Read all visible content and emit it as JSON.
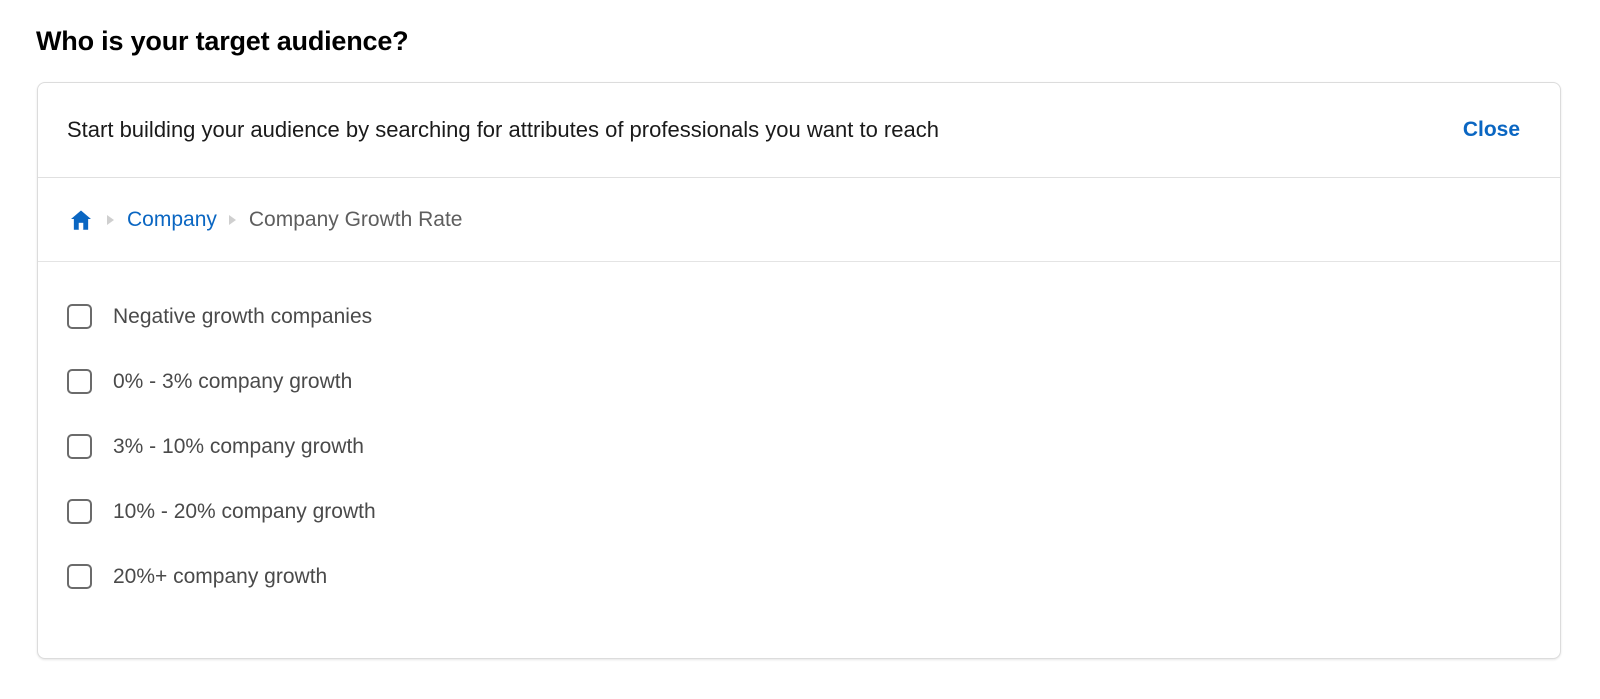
{
  "page": {
    "title": "Who is your target audience?"
  },
  "card": {
    "header": {
      "description": "Start building your audience by searching for attributes of professionals you want to reach",
      "close_label": "Close"
    },
    "breadcrumb": {
      "home_icon": "home-icon",
      "separator_icon": "caret-right-icon",
      "items": [
        {
          "label": "Company",
          "type": "link"
        },
        {
          "label": "Company Growth Rate",
          "type": "current"
        }
      ]
    },
    "options": [
      {
        "label": "Negative growth companies",
        "checked": false
      },
      {
        "label": "0% - 3% company growth",
        "checked": false
      },
      {
        "label": "3% - 10% company growth",
        "checked": false
      },
      {
        "label": "10% - 20% company growth",
        "checked": false
      },
      {
        "label": "20%+ company growth",
        "checked": false
      }
    ]
  },
  "colors": {
    "link": "#0a66c2",
    "text_primary": "#1a1a1a",
    "text_secondary": "#4a4a4a",
    "text_muted": "#5e5e5e",
    "border": "#dcdcdc",
    "background": "#ffffff"
  }
}
